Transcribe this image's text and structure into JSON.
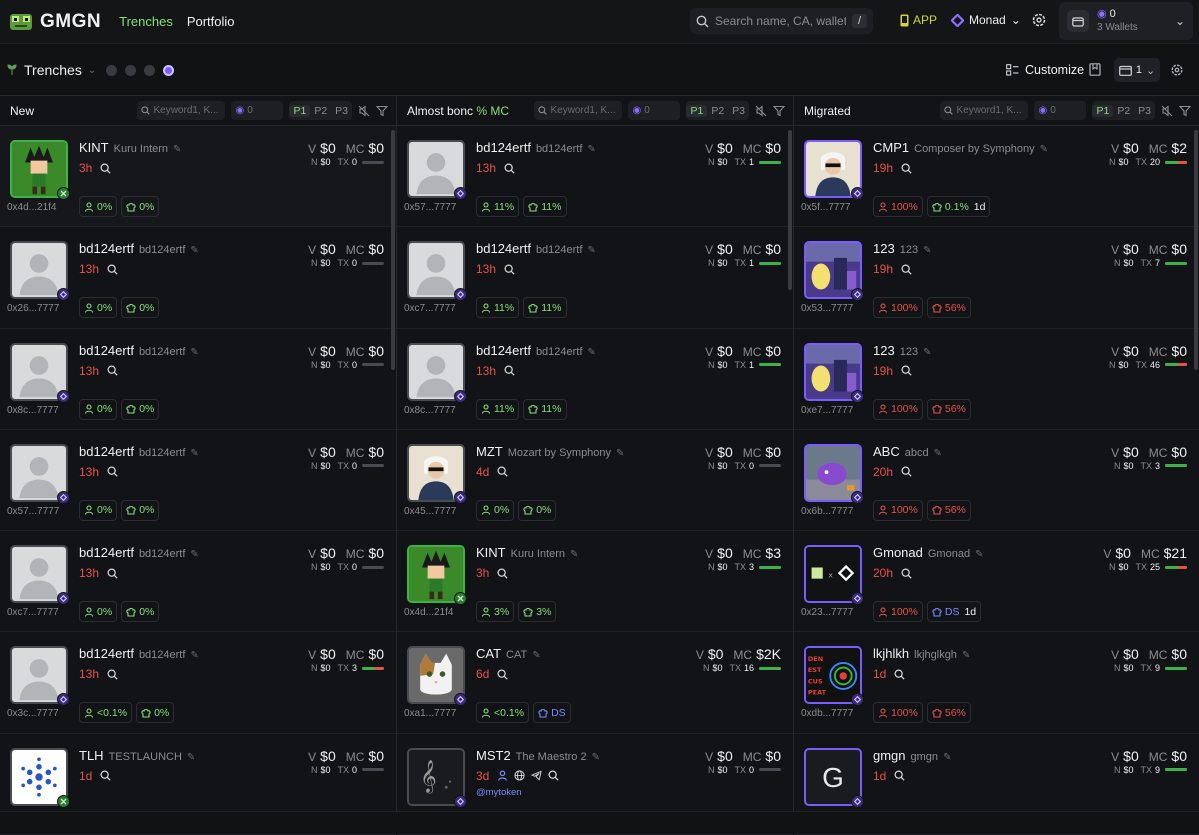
{
  "brand": {
    "name": "GMGN"
  },
  "nav": {
    "trenches": "Trenches",
    "portfolio": "Portfolio"
  },
  "search": {
    "placeholder": "Search name, CA, wallet",
    "shortcut": "/"
  },
  "header": {
    "app": "APP",
    "chain": "Monad",
    "wallet_count": "0",
    "wallet_label": "3 Wallets"
  },
  "subbar": {
    "title": "Trenches",
    "customize": "Customize",
    "layout_num": "1"
  },
  "filters": {
    "keyword_placeholder": "Keyword1, K...",
    "min_value": "0",
    "p1": "P1",
    "p2": "P2",
    "p3": "P3"
  },
  "columns": [
    {
      "title": "New",
      "tag": "",
      "rows": [
        {
          "sym": "KINT",
          "full": "Kuru Intern",
          "age": "3h",
          "addr": "0x4d...21f4",
          "v": "$0",
          "mc": "$0",
          "n": "$0",
          "tx": "0",
          "p1": "0%",
          "p2": "0%",
          "img": "kint",
          "badge": "g",
          "border": "green"
        },
        {
          "sym": "bd124ertf",
          "full": "bd124ertf",
          "age": "13h",
          "addr": "0x26...7777",
          "v": "$0",
          "mc": "$0",
          "n": "$0",
          "tx": "0",
          "p1": "0%",
          "p2": "0%",
          "img": "person",
          "badge": "p",
          "border": "grey"
        },
        {
          "sym": "bd124ertf",
          "full": "bd124ertf",
          "age": "13h",
          "addr": "0x8c...7777",
          "v": "$0",
          "mc": "$0",
          "n": "$0",
          "tx": "0",
          "p1": "0%",
          "p2": "0%",
          "img": "person",
          "badge": "p",
          "border": "grey"
        },
        {
          "sym": "bd124ertf",
          "full": "bd124ertf",
          "age": "13h",
          "addr": "0x57...7777",
          "v": "$0",
          "mc": "$0",
          "n": "$0",
          "tx": "0",
          "p1": "0%",
          "p2": "0%",
          "img": "person",
          "badge": "p",
          "border": "grey"
        },
        {
          "sym": "bd124ertf",
          "full": "bd124ertf",
          "age": "13h",
          "addr": "0xc7...7777",
          "v": "$0",
          "mc": "$0",
          "n": "$0",
          "tx": "0",
          "p1": "0%",
          "p2": "0%",
          "img": "person",
          "badge": "p",
          "border": "grey"
        },
        {
          "sym": "bd124ertf",
          "full": "bd124ertf",
          "age": "13h",
          "addr": "0x3c...7777",
          "v": "$0",
          "mc": "$0",
          "n": "$0",
          "tx": "3",
          "p1": "<0.1%",
          "p2": "0%",
          "img": "person",
          "badge": "p",
          "border": "grey"
        },
        {
          "sym": "TLH",
          "full": "TESTLAUNCH",
          "age": "1d",
          "addr": "",
          "v": "$0",
          "mc": "$0",
          "n": "$0",
          "tx": "0",
          "p1": "",
          "p2": "",
          "img": "dots",
          "badge": "g",
          "border": "grey"
        }
      ]
    },
    {
      "title": "Almost bonc",
      "tag": "% MC",
      "rows": [
        {
          "sym": "bd124ertf",
          "full": "bd124ertf",
          "age": "13h",
          "addr": "0x57...7777",
          "v": "$0",
          "mc": "$0",
          "n": "$0",
          "tx": "1",
          "p1": "11%",
          "p2": "11%",
          "img": "person",
          "badge": "p",
          "border": "grey"
        },
        {
          "sym": "bd124ertf",
          "full": "bd124ertf",
          "age": "13h",
          "addr": "0xc7...7777",
          "v": "$0",
          "mc": "$0",
          "n": "$0",
          "tx": "1",
          "p1": "11%",
          "p2": "11%",
          "img": "person",
          "badge": "p",
          "border": "grey"
        },
        {
          "sym": "bd124ertf",
          "full": "bd124ertf",
          "age": "13h",
          "addr": "0x8c...7777",
          "v": "$0",
          "mc": "$0",
          "n": "$0",
          "tx": "1",
          "p1": "11%",
          "p2": "11%",
          "img": "person",
          "badge": "p",
          "border": "grey"
        },
        {
          "sym": "MZT",
          "full": "Mozart by Symphony",
          "age": "4d",
          "addr": "0x45...7777",
          "v": "$0",
          "mc": "$0",
          "n": "$0",
          "tx": "0",
          "p1": "0%",
          "p2": "0%",
          "img": "mozart",
          "badge": "p",
          "border": "grey"
        },
        {
          "sym": "KINT",
          "full": "Kuru Intern",
          "age": "3h",
          "addr": "0x4d...21f4",
          "v": "$0",
          "mc": "$3",
          "n": "$0",
          "tx": "3",
          "p1": "3%",
          "p2": "3%",
          "img": "kint",
          "badge": "g",
          "border": "green"
        },
        {
          "sym": "CAT",
          "full": "CAT",
          "age": "6d",
          "addr": "0xa1...7777",
          "v": "$0",
          "mc": "$2K",
          "n": "$0",
          "tx": "16",
          "p1": "<0.1%",
          "p2": "DS",
          "img": "cat",
          "badge": "p",
          "border": "grey"
        },
        {
          "sym": "MST2",
          "full": "The Maestro 2",
          "age": "3d",
          "addr": "",
          "v": "$0",
          "mc": "$0",
          "n": "$0",
          "tx": "0",
          "p1": "",
          "p2": "",
          "img": "music",
          "badge": "p",
          "border": "grey",
          "handle": "@mytoken"
        }
      ]
    },
    {
      "title": "Migrated",
      "tag": "",
      "rows": [
        {
          "sym": "CMP1",
          "full": "Composer by Symphony",
          "age": "19h",
          "addr": "0x5f...7777",
          "v": "$0",
          "mc": "$2",
          "n": "$0",
          "tx": "20",
          "p1": "100%",
          "p2": "0.1%",
          "p2extra": "1d",
          "img": "mozart",
          "badge": "p",
          "border": "purple"
        },
        {
          "sym": "123",
          "full": "123",
          "age": "19h",
          "addr": "0x53...7777",
          "v": "$0",
          "mc": "$0",
          "n": "$0",
          "tx": "7",
          "p1": "100%",
          "p2": "56%",
          "img": "scene",
          "badge": "p",
          "border": "purple"
        },
        {
          "sym": "123",
          "full": "123",
          "age": "19h",
          "addr": "0xe7...7777",
          "v": "$0",
          "mc": "$0",
          "n": "$0",
          "tx": "46",
          "p1": "100%",
          "p2": "56%",
          "img": "scene",
          "badge": "p",
          "border": "purple"
        },
        {
          "sym": "ABC",
          "full": "abcd",
          "age": "20h",
          "addr": "0x6b...7777",
          "v": "$0",
          "mc": "$0",
          "n": "$0",
          "tx": "3",
          "p1": "100%",
          "p2": "56%",
          "img": "scene2",
          "badge": "p",
          "border": "purple"
        },
        {
          "sym": "Gmonad",
          "full": "Gmonad",
          "age": "20h",
          "addr": "0x23...7777",
          "v": "$0",
          "mc": "$21",
          "n": "$0",
          "tx": "25",
          "p1": "100%",
          "p2": "DS",
          "p2extra": "1d",
          "img": "gmonad",
          "badge": "p",
          "border": "purple"
        },
        {
          "sym": "lkjhlkh",
          "full": "lkjhglkgh",
          "age": "1d",
          "addr": "0xdb...7777",
          "v": "$0",
          "mc": "$0",
          "n": "$0",
          "tx": "9",
          "p1": "100%",
          "p2": "56%",
          "img": "poster",
          "badge": "p",
          "border": "purple"
        },
        {
          "sym": "gmgn",
          "full": "gmgn",
          "age": "1d",
          "addr": "",
          "v": "$0",
          "mc": "$0",
          "n": "$0",
          "tx": "9",
          "p1": "",
          "p2": "",
          "img": "letter",
          "badge": "p",
          "border": "purple",
          "letter": "G"
        }
      ]
    }
  ],
  "labels": {
    "v": "V",
    "mc": "MC",
    "n": "N",
    "tx": "TX"
  }
}
